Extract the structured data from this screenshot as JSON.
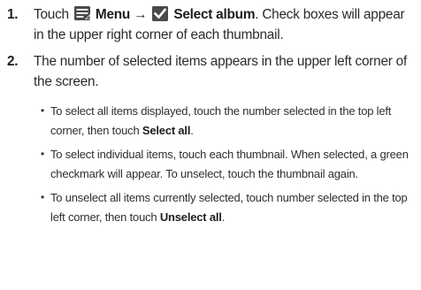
{
  "steps": [
    {
      "number": "1.",
      "pre_menu": "Touch",
      "menu_icon": "menu-icon",
      "menu_label": "Menu",
      "arrow": "→",
      "check_icon": "checkbox-checked-icon",
      "select_album_label": "Select album",
      "text_after": ". Check boxes will appear in the upper right corner of each thumbnail."
    },
    {
      "number": "2.",
      "text": "The number of selected items appears in the upper left corner of the screen."
    }
  ],
  "bullets": [
    {
      "text_before": "To select all items displayed, touch the number selected in the top left corner, then touch ",
      "bold": "Select all",
      "text_after": "."
    },
    {
      "text": "To select individual items, touch each thumbnail. When selected, a green checkmark will appear. To unselect, touch the thumbnail again."
    },
    {
      "text_before": "To unselect all items currently selected, touch number selected in the top left corner, then touch ",
      "bold": "Unselect all",
      "text_after": "."
    }
  ],
  "bullet_glyph": "•",
  "colors": {
    "icon_fill": "#4a4a4a",
    "text": "#2b2b2b"
  }
}
